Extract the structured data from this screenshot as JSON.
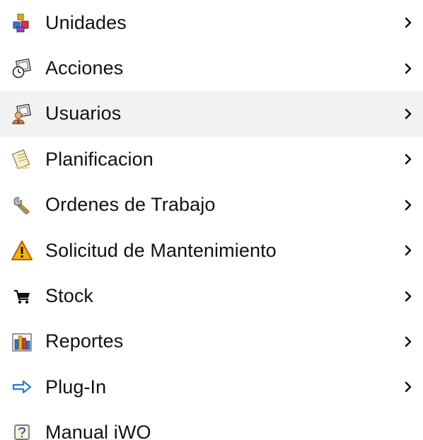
{
  "menu": {
    "items": [
      {
        "label": "Unidades",
        "icon": "cubes-icon",
        "has_submenu": true,
        "active": false
      },
      {
        "label": "Acciones",
        "icon": "actions-clock-icon",
        "has_submenu": true,
        "active": false
      },
      {
        "label": "Usuarios",
        "icon": "users-icon",
        "has_submenu": true,
        "active": true
      },
      {
        "label": "Planificacion",
        "icon": "document-plan-icon",
        "has_submenu": true,
        "active": false
      },
      {
        "label": "Ordenes de Trabajo",
        "icon": "wrench-icon",
        "has_submenu": true,
        "active": false
      },
      {
        "label": "Solicitud de Mantenimiento",
        "icon": "warning-icon",
        "has_submenu": true,
        "active": false
      },
      {
        "label": "Stock",
        "icon": "cart-icon",
        "has_submenu": true,
        "active": false
      },
      {
        "label": "Reportes",
        "icon": "bar-chart-icon",
        "has_submenu": true,
        "active": false
      },
      {
        "label": "Plug-In",
        "icon": "arrow-right-icon",
        "has_submenu": true,
        "active": false
      },
      {
        "label": "Manual iWO",
        "icon": "help-icon",
        "has_submenu": false,
        "active": false
      }
    ]
  },
  "colors": {
    "active_row_background": "#f2f2f2",
    "text": "#111111",
    "warning": "#f2b705",
    "arrow_blue": "#2a78d6"
  }
}
